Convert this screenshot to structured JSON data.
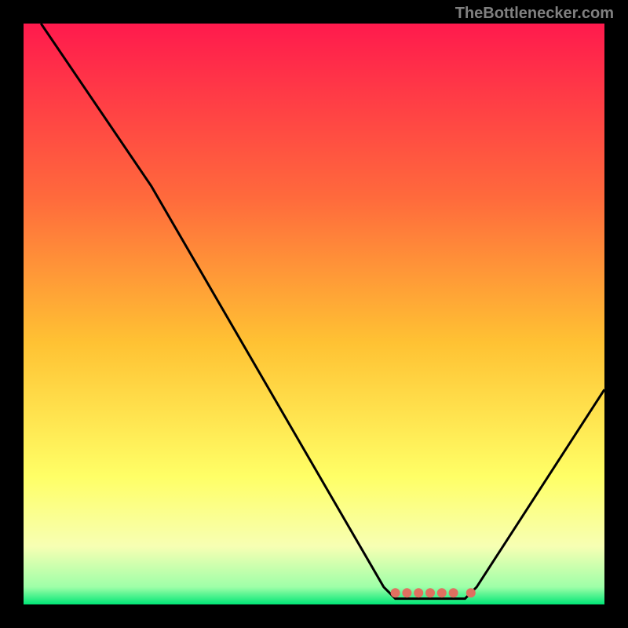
{
  "watermark": "TheBottleneсker.com",
  "chart_data": {
    "type": "line",
    "title": "",
    "xlabel": "",
    "ylabel": "",
    "xlim": [
      0,
      100
    ],
    "ylim": [
      0,
      100
    ],
    "gradient_stops": [
      {
        "offset": 0,
        "color": "#ff1a4d"
      },
      {
        "offset": 30,
        "color": "#ff6a3c"
      },
      {
        "offset": 55,
        "color": "#ffc233"
      },
      {
        "offset": 78,
        "color": "#ffff66"
      },
      {
        "offset": 90,
        "color": "#f7ffb3"
      },
      {
        "offset": 97,
        "color": "#9effa8"
      },
      {
        "offset": 100,
        "color": "#00e676"
      }
    ],
    "series": [
      {
        "name": "bottleneck-curve",
        "color": "#000000",
        "points": [
          {
            "x": 3,
            "y": 100
          },
          {
            "x": 22,
            "y": 72
          },
          {
            "x": 62,
            "y": 3
          },
          {
            "x": 64,
            "y": 1
          },
          {
            "x": 76,
            "y": 1
          },
          {
            "x": 78,
            "y": 3
          },
          {
            "x": 100,
            "y": 37
          }
        ]
      }
    ],
    "markers": [
      {
        "x": 64,
        "y": 2,
        "color": "#e07060"
      },
      {
        "x": 66,
        "y": 2,
        "color": "#e07060"
      },
      {
        "x": 68,
        "y": 2,
        "color": "#e07060"
      },
      {
        "x": 70,
        "y": 2,
        "color": "#e07060"
      },
      {
        "x": 72,
        "y": 2,
        "color": "#e07060"
      },
      {
        "x": 74,
        "y": 2,
        "color": "#e07060"
      },
      {
        "x": 77,
        "y": 2,
        "color": "#e07060"
      }
    ]
  }
}
